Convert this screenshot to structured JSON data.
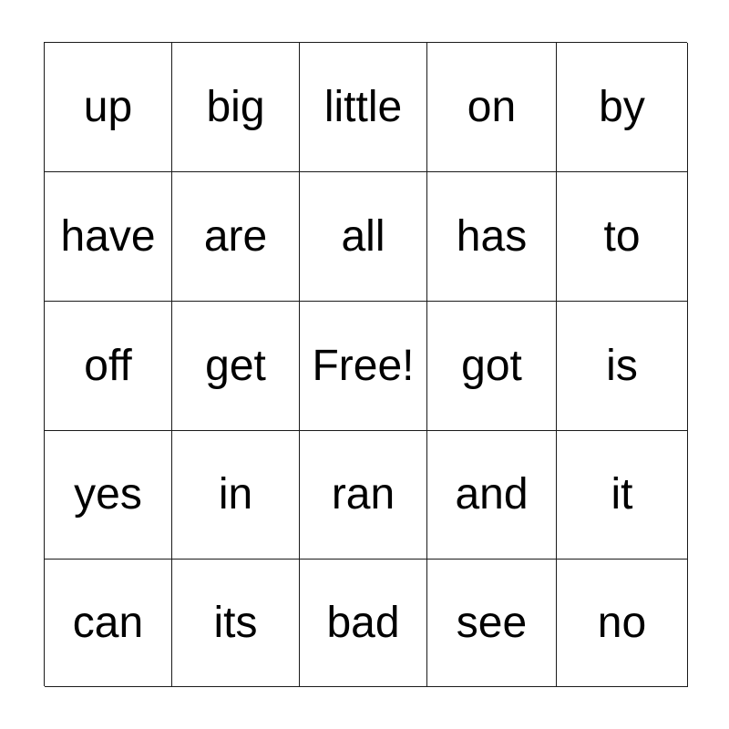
{
  "card": {
    "type": "bingo-card",
    "rows": 5,
    "columns": 5,
    "free_space_label": "Free!",
    "free_space_position": {
      "row": 3,
      "column": 3
    },
    "border_color": "#1a1a1a",
    "text_color": "#000000",
    "background_color": "#ffffff",
    "cells": [
      [
        {
          "text": "up"
        },
        {
          "text": "big"
        },
        {
          "text": "little"
        },
        {
          "text": "on"
        },
        {
          "text": "by"
        }
      ],
      [
        {
          "text": "have"
        },
        {
          "text": "are"
        },
        {
          "text": "all"
        },
        {
          "text": "has"
        },
        {
          "text": "to"
        }
      ],
      [
        {
          "text": "off"
        },
        {
          "text": "get"
        },
        {
          "text": "Free!"
        },
        {
          "text": "got"
        },
        {
          "text": "is"
        }
      ],
      [
        {
          "text": "yes"
        },
        {
          "text": "in"
        },
        {
          "text": "ran"
        },
        {
          "text": "and"
        },
        {
          "text": "it"
        }
      ],
      [
        {
          "text": "can"
        },
        {
          "text": "its"
        },
        {
          "text": "bad"
        },
        {
          "text": "see"
        },
        {
          "text": "no"
        }
      ]
    ]
  }
}
